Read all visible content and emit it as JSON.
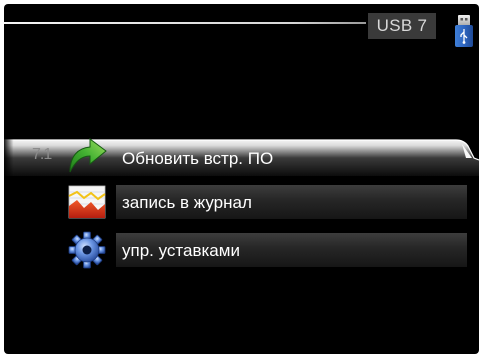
{
  "header": {
    "title": "USB 7",
    "usb_icon": "usb-stick-icon"
  },
  "menu": {
    "items": [
      {
        "number": "7.1",
        "label": "Обновить встр. ПО",
        "icon": "update-arrow-icon",
        "selected": true
      },
      {
        "number": "",
        "label": "запись в журнал",
        "icon": "log-chart-icon",
        "selected": false
      },
      {
        "number": "",
        "label": "упр. уставками",
        "icon": "gear-icon",
        "selected": false
      }
    ]
  },
  "colors": {
    "background": "#000000",
    "selected_bar": "#e6e6e6",
    "text": "#ffffff",
    "header_box": "#3a3a3a",
    "arrow_green": "#3fa62e",
    "chart_red": "#e03a1e",
    "gear_blue": "#5a87d8"
  }
}
